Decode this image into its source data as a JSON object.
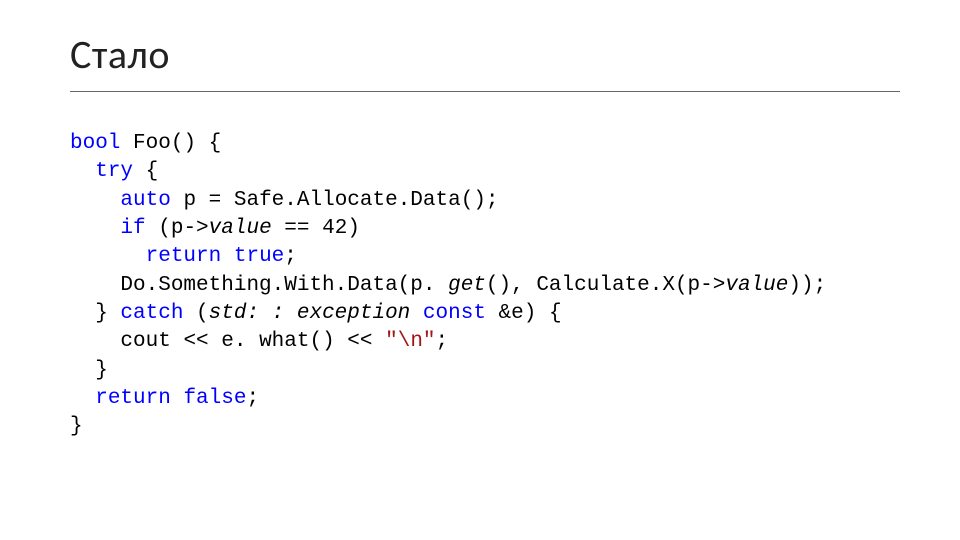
{
  "title": "Стало",
  "code": {
    "kw_bool": "bool",
    "fn_foo": "Foo",
    "kw_try": "try",
    "kw_auto": "auto",
    "var_p": "p",
    "fn_safe_alloc": "Safe.Allocate.Data",
    "kw_if": "if",
    "mem_value": "value",
    "lit_42": "42",
    "kw_return1": "return",
    "kw_true": "true",
    "fn_do_something": "Do.Something.With.Data",
    "fn_get": "get",
    "fn_calcx": "Calculate.X",
    "kw_catch": "catch",
    "typ_std_exception": "std: : exception",
    "kw_const": "const",
    "var_e": "e",
    "fn_cout": "cout",
    "fn_what": "e. what",
    "str_nl": "\"\\n\"",
    "kw_return2": "return",
    "kw_false": "false"
  }
}
